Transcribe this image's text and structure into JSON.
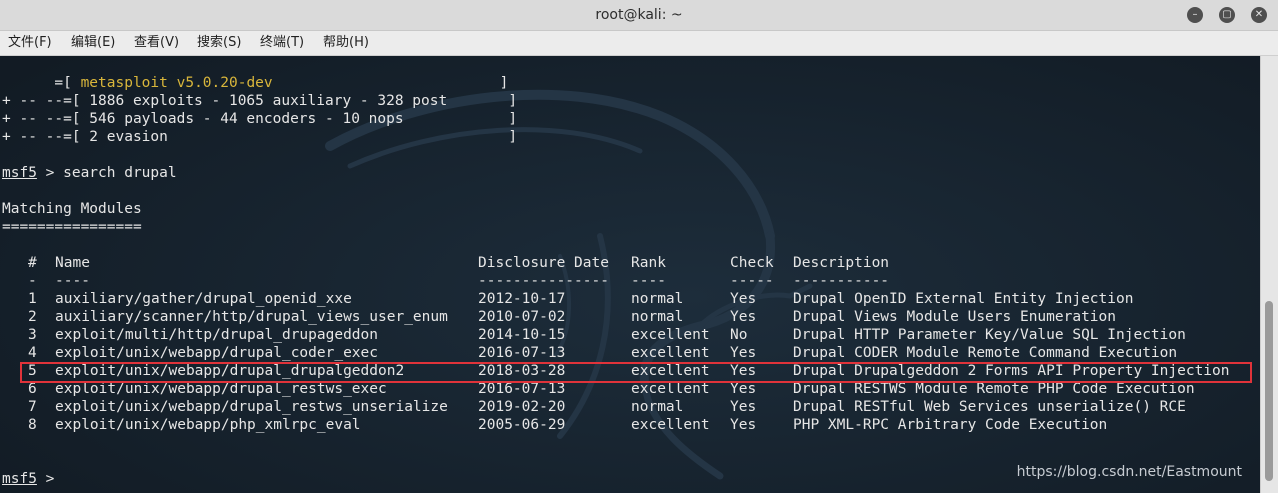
{
  "window": {
    "title": "root@kali: ~"
  },
  "menu": [
    "文件(F)",
    "编辑(E)",
    "查看(V)",
    "搜索(S)",
    "终端(T)",
    "帮助(H)"
  ],
  "banner": {
    "l1_prefix": "      =[ ",
    "l1_name": "metasploit v5.0.20-dev",
    "l1_suffix": "                          ]",
    "l2": "+ -- --=[ 1886 exploits - 1065 auxiliary - 328 post       ]",
    "l3": "+ -- --=[ 546 payloads - 44 encoders - 10 nops            ]",
    "l4": "+ -- --=[ 2 evasion                                       ]"
  },
  "prompt1": {
    "prompt": "msf5",
    "command": " > search drupal"
  },
  "matching": {
    "title": "Matching Modules",
    "underline": "================"
  },
  "table": {
    "headers": {
      "num": "#",
      "name": "Name",
      "date": "Disclosure Date",
      "rank": "Rank",
      "check": "Check",
      "desc": "Description"
    },
    "separators": {
      "num": "-",
      "name": "----",
      "date": "---------------",
      "rank": "----",
      "check": "-----",
      "desc": "-----------"
    },
    "rows": [
      {
        "num": "1",
        "name": "auxiliary/gather/drupal_openid_xxe",
        "date": "2012-10-17",
        "rank": "normal",
        "check": "Yes",
        "desc": "Drupal OpenID External Entity Injection"
      },
      {
        "num": "2",
        "name": "auxiliary/scanner/http/drupal_views_user_enum",
        "date": "2010-07-02",
        "rank": "normal",
        "check": "Yes",
        "desc": "Drupal Views Module Users Enumeration"
      },
      {
        "num": "3",
        "name": "exploit/multi/http/drupal_drupageddon",
        "date": "2014-10-15",
        "rank": "excellent",
        "check": "No",
        "desc": "Drupal HTTP Parameter Key/Value SQL Injection"
      },
      {
        "num": "4",
        "name": "exploit/unix/webapp/drupal_coder_exec",
        "date": "2016-07-13",
        "rank": "excellent",
        "check": "Yes",
        "desc": "Drupal CODER Module Remote Command Execution"
      },
      {
        "num": "5",
        "name": "exploit/unix/webapp/drupal_drupalgeddon2",
        "date": "2018-03-28",
        "rank": "excellent",
        "check": "Yes",
        "desc": "Drupal Drupalgeddon 2 Forms API Property Injection"
      },
      {
        "num": "6",
        "name": "exploit/unix/webapp/drupal_restws_exec",
        "date": "2016-07-13",
        "rank": "excellent",
        "check": "Yes",
        "desc": "Drupal RESTWS Module Remote PHP Code Execution"
      },
      {
        "num": "7",
        "name": "exploit/unix/webapp/drupal_restws_unserialize",
        "date": "2019-02-20",
        "rank": "normal",
        "check": "Yes",
        "desc": "Drupal RESTful Web Services unserialize() RCE"
      },
      {
        "num": "8",
        "name": "exploit/unix/webapp/php_xmlrpc_eval",
        "date": "2005-06-29",
        "rank": "excellent",
        "check": "Yes",
        "desc": "PHP XML-RPC Arbitrary Code Execution"
      }
    ]
  },
  "prompt2": {
    "prompt": "msf5",
    "command": " >"
  },
  "watermark": "https://blog.csdn.net/Eastmount",
  "colors": {
    "highlight": "#e0333a",
    "banner_name": "#d9b63b",
    "terminal_bg": "#16222d"
  }
}
